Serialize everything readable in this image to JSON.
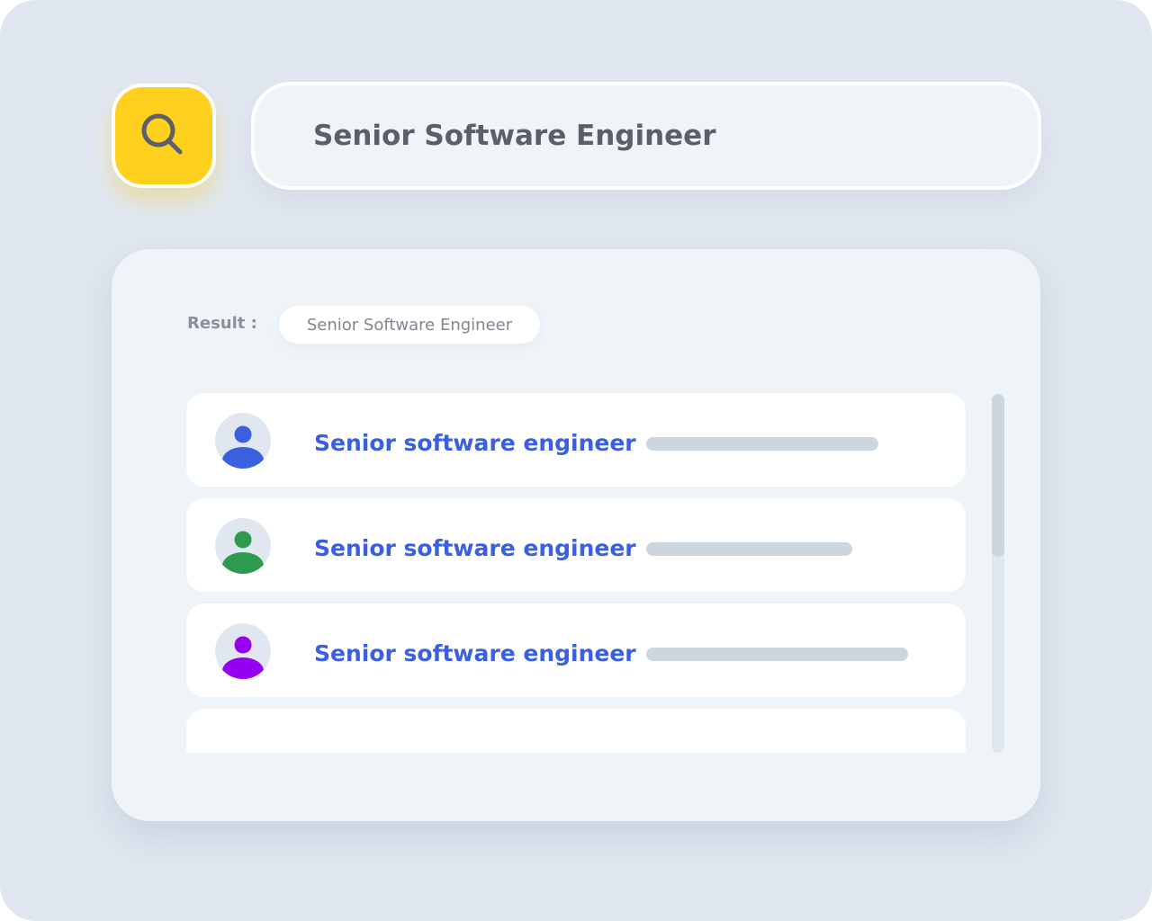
{
  "search": {
    "value": "Senior Software Engineer",
    "button_icon": "search-icon"
  },
  "results": {
    "label": "Result :",
    "filter_chip": "Senior Software Engineer",
    "items": [
      {
        "title": "Senior software engineer",
        "avatar_color": "#3a5fe0",
        "avatar_icon": "user-icon",
        "bar_fill": 0.52
      },
      {
        "title": "Senior software engineer",
        "avatar_color": "#2c9a4f",
        "avatar_icon": "user-icon",
        "bar_fill": 0.46
      },
      {
        "title": "Senior software engineer",
        "avatar_color": "#9500f0",
        "avatar_icon": "user-icon",
        "bar_fill": 0.59
      },
      {
        "title": "",
        "avatar_color": "",
        "avatar_icon": "",
        "bar_fill": 0
      }
    ]
  },
  "colors": {
    "background": "#e1e7f0",
    "search_button": "#ffd01e",
    "accent_text": "#3a5fe0",
    "placeholder_bar": "#cdd6dd"
  }
}
